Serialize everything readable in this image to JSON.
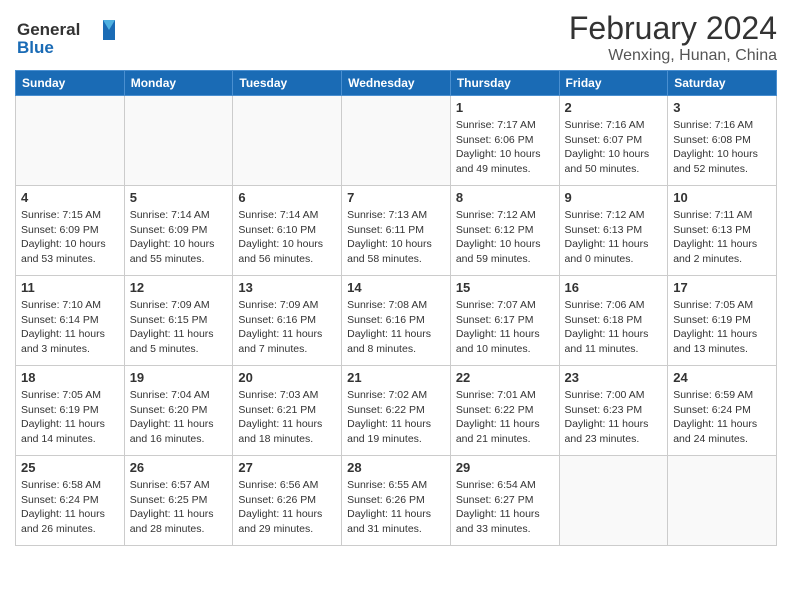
{
  "logo": {
    "line1": "General",
    "line2": "Blue"
  },
  "title": "February 2024",
  "subtitle": "Wenxing, Hunan, China",
  "weekdays": [
    "Sunday",
    "Monday",
    "Tuesday",
    "Wednesday",
    "Thursday",
    "Friday",
    "Saturday"
  ],
  "weeks": [
    [
      {
        "day": "",
        "info": ""
      },
      {
        "day": "",
        "info": ""
      },
      {
        "day": "",
        "info": ""
      },
      {
        "day": "",
        "info": ""
      },
      {
        "day": "1",
        "info": "Sunrise: 7:17 AM\nSunset: 6:06 PM\nDaylight: 10 hours\nand 49 minutes."
      },
      {
        "day": "2",
        "info": "Sunrise: 7:16 AM\nSunset: 6:07 PM\nDaylight: 10 hours\nand 50 minutes."
      },
      {
        "day": "3",
        "info": "Sunrise: 7:16 AM\nSunset: 6:08 PM\nDaylight: 10 hours\nand 52 minutes."
      }
    ],
    [
      {
        "day": "4",
        "info": "Sunrise: 7:15 AM\nSunset: 6:09 PM\nDaylight: 10 hours\nand 53 minutes."
      },
      {
        "day": "5",
        "info": "Sunrise: 7:14 AM\nSunset: 6:09 PM\nDaylight: 10 hours\nand 55 minutes."
      },
      {
        "day": "6",
        "info": "Sunrise: 7:14 AM\nSunset: 6:10 PM\nDaylight: 10 hours\nand 56 minutes."
      },
      {
        "day": "7",
        "info": "Sunrise: 7:13 AM\nSunset: 6:11 PM\nDaylight: 10 hours\nand 58 minutes."
      },
      {
        "day": "8",
        "info": "Sunrise: 7:12 AM\nSunset: 6:12 PM\nDaylight: 10 hours\nand 59 minutes."
      },
      {
        "day": "9",
        "info": "Sunrise: 7:12 AM\nSunset: 6:13 PM\nDaylight: 11 hours\nand 0 minutes."
      },
      {
        "day": "10",
        "info": "Sunrise: 7:11 AM\nSunset: 6:13 PM\nDaylight: 11 hours\nand 2 minutes."
      }
    ],
    [
      {
        "day": "11",
        "info": "Sunrise: 7:10 AM\nSunset: 6:14 PM\nDaylight: 11 hours\nand 3 minutes."
      },
      {
        "day": "12",
        "info": "Sunrise: 7:09 AM\nSunset: 6:15 PM\nDaylight: 11 hours\nand 5 minutes."
      },
      {
        "day": "13",
        "info": "Sunrise: 7:09 AM\nSunset: 6:16 PM\nDaylight: 11 hours\nand 7 minutes."
      },
      {
        "day": "14",
        "info": "Sunrise: 7:08 AM\nSunset: 6:16 PM\nDaylight: 11 hours\nand 8 minutes."
      },
      {
        "day": "15",
        "info": "Sunrise: 7:07 AM\nSunset: 6:17 PM\nDaylight: 11 hours\nand 10 minutes."
      },
      {
        "day": "16",
        "info": "Sunrise: 7:06 AM\nSunset: 6:18 PM\nDaylight: 11 hours\nand 11 minutes."
      },
      {
        "day": "17",
        "info": "Sunrise: 7:05 AM\nSunset: 6:19 PM\nDaylight: 11 hours\nand 13 minutes."
      }
    ],
    [
      {
        "day": "18",
        "info": "Sunrise: 7:05 AM\nSunset: 6:19 PM\nDaylight: 11 hours\nand 14 minutes."
      },
      {
        "day": "19",
        "info": "Sunrise: 7:04 AM\nSunset: 6:20 PM\nDaylight: 11 hours\nand 16 minutes."
      },
      {
        "day": "20",
        "info": "Sunrise: 7:03 AM\nSunset: 6:21 PM\nDaylight: 11 hours\nand 18 minutes."
      },
      {
        "day": "21",
        "info": "Sunrise: 7:02 AM\nSunset: 6:22 PM\nDaylight: 11 hours\nand 19 minutes."
      },
      {
        "day": "22",
        "info": "Sunrise: 7:01 AM\nSunset: 6:22 PM\nDaylight: 11 hours\nand 21 minutes."
      },
      {
        "day": "23",
        "info": "Sunrise: 7:00 AM\nSunset: 6:23 PM\nDaylight: 11 hours\nand 23 minutes."
      },
      {
        "day": "24",
        "info": "Sunrise: 6:59 AM\nSunset: 6:24 PM\nDaylight: 11 hours\nand 24 minutes."
      }
    ],
    [
      {
        "day": "25",
        "info": "Sunrise: 6:58 AM\nSunset: 6:24 PM\nDaylight: 11 hours\nand 26 minutes."
      },
      {
        "day": "26",
        "info": "Sunrise: 6:57 AM\nSunset: 6:25 PM\nDaylight: 11 hours\nand 28 minutes."
      },
      {
        "day": "27",
        "info": "Sunrise: 6:56 AM\nSunset: 6:26 PM\nDaylight: 11 hours\nand 29 minutes."
      },
      {
        "day": "28",
        "info": "Sunrise: 6:55 AM\nSunset: 6:26 PM\nDaylight: 11 hours\nand 31 minutes."
      },
      {
        "day": "29",
        "info": "Sunrise: 6:54 AM\nSunset: 6:27 PM\nDaylight: 11 hours\nand 33 minutes."
      },
      {
        "day": "",
        "info": ""
      },
      {
        "day": "",
        "info": ""
      }
    ]
  ]
}
